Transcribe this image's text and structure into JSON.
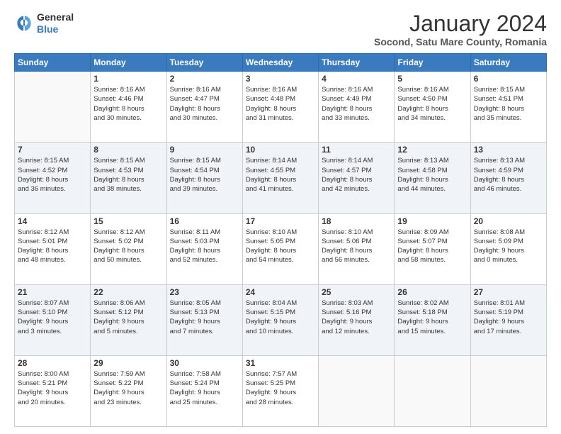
{
  "logo": {
    "line1": "General",
    "line2": "Blue"
  },
  "title": "January 2024",
  "subtitle": "Socond, Satu Mare County, Romania",
  "days_header": [
    "Sunday",
    "Monday",
    "Tuesday",
    "Wednesday",
    "Thursday",
    "Friday",
    "Saturday"
  ],
  "weeks": [
    [
      {
        "day": "",
        "info": ""
      },
      {
        "day": "1",
        "info": "Sunrise: 8:16 AM\nSunset: 4:46 PM\nDaylight: 8 hours\nand 30 minutes."
      },
      {
        "day": "2",
        "info": "Sunrise: 8:16 AM\nSunset: 4:47 PM\nDaylight: 8 hours\nand 30 minutes."
      },
      {
        "day": "3",
        "info": "Sunrise: 8:16 AM\nSunset: 4:48 PM\nDaylight: 8 hours\nand 31 minutes."
      },
      {
        "day": "4",
        "info": "Sunrise: 8:16 AM\nSunset: 4:49 PM\nDaylight: 8 hours\nand 33 minutes."
      },
      {
        "day": "5",
        "info": "Sunrise: 8:16 AM\nSunset: 4:50 PM\nDaylight: 8 hours\nand 34 minutes."
      },
      {
        "day": "6",
        "info": "Sunrise: 8:15 AM\nSunset: 4:51 PM\nDaylight: 8 hours\nand 35 minutes."
      }
    ],
    [
      {
        "day": "7",
        "info": "Sunrise: 8:15 AM\nSunset: 4:52 PM\nDaylight: 8 hours\nand 36 minutes."
      },
      {
        "day": "8",
        "info": "Sunrise: 8:15 AM\nSunset: 4:53 PM\nDaylight: 8 hours\nand 38 minutes."
      },
      {
        "day": "9",
        "info": "Sunrise: 8:15 AM\nSunset: 4:54 PM\nDaylight: 8 hours\nand 39 minutes."
      },
      {
        "day": "10",
        "info": "Sunrise: 8:14 AM\nSunset: 4:55 PM\nDaylight: 8 hours\nand 41 minutes."
      },
      {
        "day": "11",
        "info": "Sunrise: 8:14 AM\nSunset: 4:57 PM\nDaylight: 8 hours\nand 42 minutes."
      },
      {
        "day": "12",
        "info": "Sunrise: 8:13 AM\nSunset: 4:58 PM\nDaylight: 8 hours\nand 44 minutes."
      },
      {
        "day": "13",
        "info": "Sunrise: 8:13 AM\nSunset: 4:59 PM\nDaylight: 8 hours\nand 46 minutes."
      }
    ],
    [
      {
        "day": "14",
        "info": "Sunrise: 8:12 AM\nSunset: 5:01 PM\nDaylight: 8 hours\nand 48 minutes."
      },
      {
        "day": "15",
        "info": "Sunrise: 8:12 AM\nSunset: 5:02 PM\nDaylight: 8 hours\nand 50 minutes."
      },
      {
        "day": "16",
        "info": "Sunrise: 8:11 AM\nSunset: 5:03 PM\nDaylight: 8 hours\nand 52 minutes."
      },
      {
        "day": "17",
        "info": "Sunrise: 8:10 AM\nSunset: 5:05 PM\nDaylight: 8 hours\nand 54 minutes."
      },
      {
        "day": "18",
        "info": "Sunrise: 8:10 AM\nSunset: 5:06 PM\nDaylight: 8 hours\nand 56 minutes."
      },
      {
        "day": "19",
        "info": "Sunrise: 8:09 AM\nSunset: 5:07 PM\nDaylight: 8 hours\nand 58 minutes."
      },
      {
        "day": "20",
        "info": "Sunrise: 8:08 AM\nSunset: 5:09 PM\nDaylight: 9 hours\nand 0 minutes."
      }
    ],
    [
      {
        "day": "21",
        "info": "Sunrise: 8:07 AM\nSunset: 5:10 PM\nDaylight: 9 hours\nand 3 minutes."
      },
      {
        "day": "22",
        "info": "Sunrise: 8:06 AM\nSunset: 5:12 PM\nDaylight: 9 hours\nand 5 minutes."
      },
      {
        "day": "23",
        "info": "Sunrise: 8:05 AM\nSunset: 5:13 PM\nDaylight: 9 hours\nand 7 minutes."
      },
      {
        "day": "24",
        "info": "Sunrise: 8:04 AM\nSunset: 5:15 PM\nDaylight: 9 hours\nand 10 minutes."
      },
      {
        "day": "25",
        "info": "Sunrise: 8:03 AM\nSunset: 5:16 PM\nDaylight: 9 hours\nand 12 minutes."
      },
      {
        "day": "26",
        "info": "Sunrise: 8:02 AM\nSunset: 5:18 PM\nDaylight: 9 hours\nand 15 minutes."
      },
      {
        "day": "27",
        "info": "Sunrise: 8:01 AM\nSunset: 5:19 PM\nDaylight: 9 hours\nand 17 minutes."
      }
    ],
    [
      {
        "day": "28",
        "info": "Sunrise: 8:00 AM\nSunset: 5:21 PM\nDaylight: 9 hours\nand 20 minutes."
      },
      {
        "day": "29",
        "info": "Sunrise: 7:59 AM\nSunset: 5:22 PM\nDaylight: 9 hours\nand 23 minutes."
      },
      {
        "day": "30",
        "info": "Sunrise: 7:58 AM\nSunset: 5:24 PM\nDaylight: 9 hours\nand 25 minutes."
      },
      {
        "day": "31",
        "info": "Sunrise: 7:57 AM\nSunset: 5:25 PM\nDaylight: 9 hours\nand 28 minutes."
      },
      {
        "day": "",
        "info": ""
      },
      {
        "day": "",
        "info": ""
      },
      {
        "day": "",
        "info": ""
      }
    ]
  ]
}
